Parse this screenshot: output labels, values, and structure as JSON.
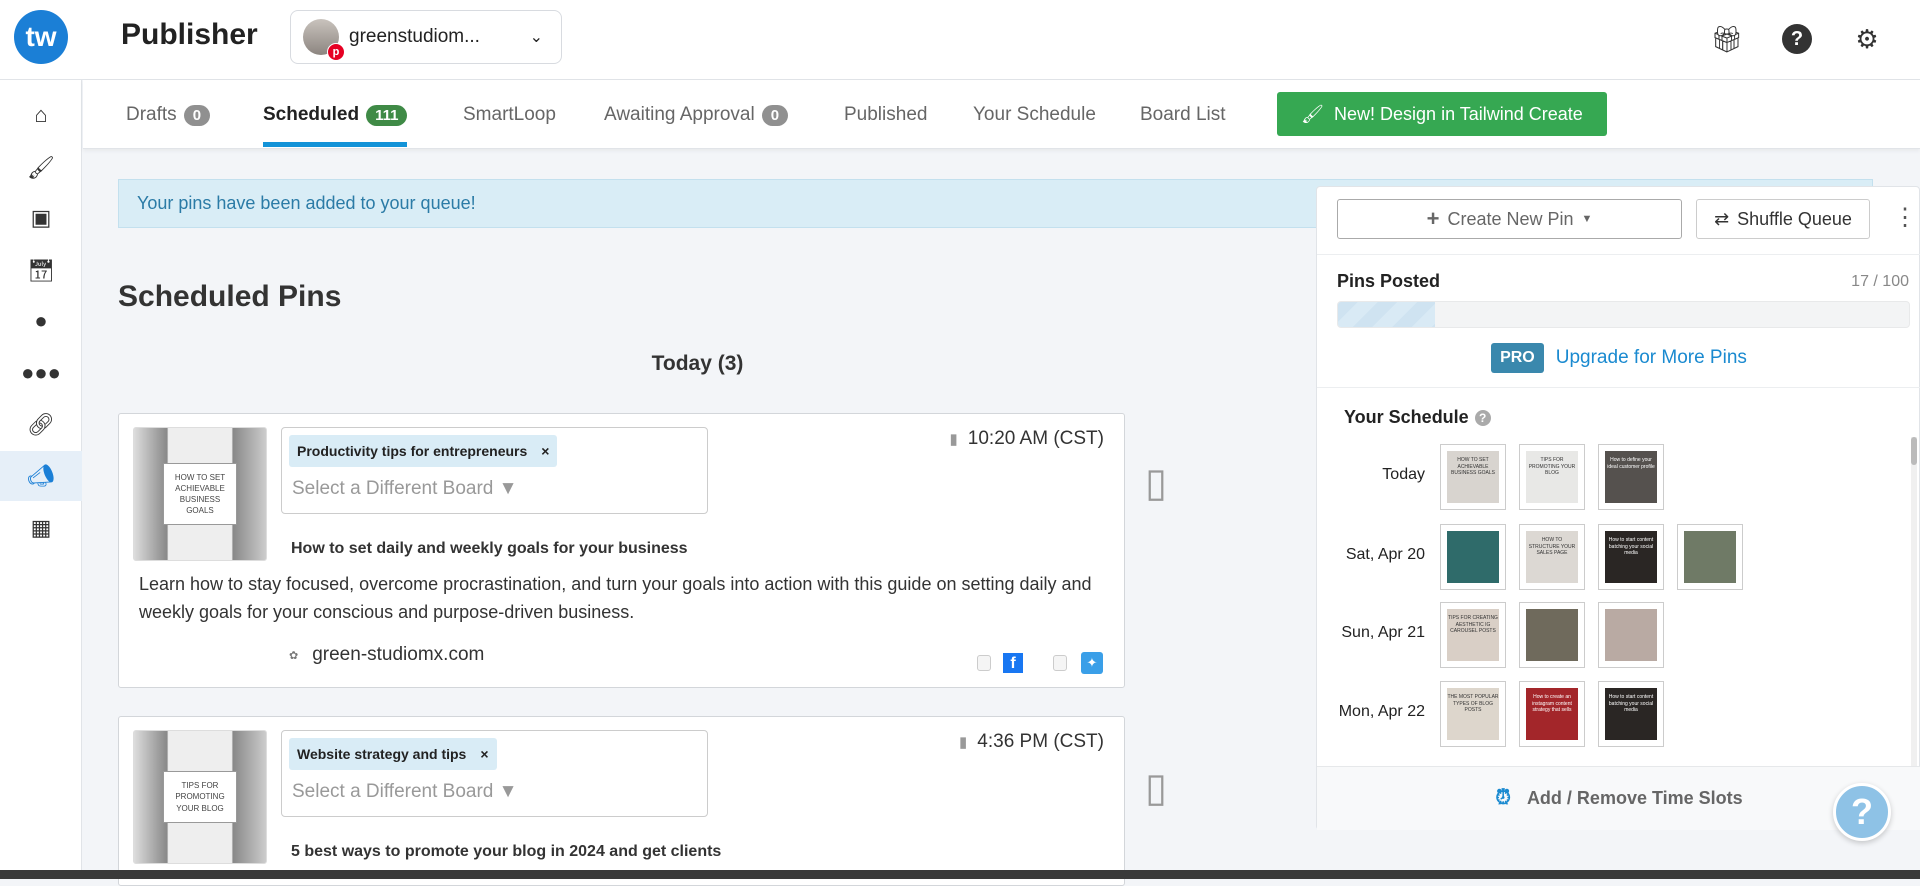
{
  "header": {
    "logo": "tw",
    "title": "Publisher",
    "account": "greenstudiom...",
    "icons": [
      "gift-icon",
      "help-icon",
      "gear-icon"
    ]
  },
  "sidebar": {
    "items": [
      {
        "icon": "home-icon"
      },
      {
        "icon": "brush-icon"
      },
      {
        "icon": "images-icon"
      },
      {
        "icon": "calendar-icon"
      },
      {
        "icon": "bird-icon"
      },
      {
        "icon": "people-icon"
      },
      {
        "icon": "link-icon"
      },
      {
        "icon": "megaphone-icon",
        "active": true
      },
      {
        "icon": "analytics-icon"
      }
    ]
  },
  "tabs": [
    {
      "label": "Drafts",
      "badge": "0"
    },
    {
      "label": "Scheduled",
      "badge": "111",
      "active": true
    },
    {
      "label": "SmartLoop"
    },
    {
      "label": "Awaiting Approval",
      "badge": "0"
    },
    {
      "label": "Published"
    },
    {
      "label": "Your Schedule"
    },
    {
      "label": "Board List"
    }
  ],
  "create_button": "New! Design in Tailwind Create",
  "alert": "Your pins have been added to your queue!",
  "main": {
    "title": "Scheduled Pins",
    "day_heading": "Today (3)",
    "pins": [
      {
        "thumb_text": "HOW TO SET ACHIEVABLE BUSINESS GOALS",
        "board": "Productivity tips for entrepreneurs",
        "remove": "×",
        "select_placeholder": "Select a Different Board ▼",
        "time": "10:20 AM (CST)",
        "title": "How to set daily and weekly goals for your business",
        "description": "Learn how to stay focused, overcome procrastination, and turn your goals into action with this guide on setting daily and weekly goals for your conscious and purpose-driven business.",
        "link": "green-studiomx.com"
      },
      {
        "thumb_text": "TIPS FOR PROMOTING YOUR BLOG",
        "board": "Website strategy and tips",
        "remove": "×",
        "select_placeholder": "Select a Different Board ▼",
        "time": "4:36 PM (CST)",
        "title": "5 best ways to promote your blog in 2024 and get clients"
      }
    ]
  },
  "panel": {
    "create_pin": "Create New Pin",
    "shuffle": "Shuffle Queue",
    "pins_posted_label": "Pins Posted",
    "pins_posted_count": "17 / 100",
    "pins_posted_fraction": 0.17,
    "pro": "PRO",
    "upgrade": "Upgrade for More Pins",
    "schedule_title": "Your Schedule",
    "footer": "Add / Remove Time Slots",
    "schedule": [
      {
        "day": "Today",
        "thumbs": [
          {
            "text": "HOW TO SET ACHIEVABLE BUSINESS GOALS",
            "color": "#d8d4cf"
          },
          {
            "text": "TIPS FOR PROMOTING YOUR BLOG",
            "color": "#e8e8e6"
          },
          {
            "text": "How to define your ideal customer profile",
            "color": "#55514e"
          }
        ]
      },
      {
        "day": "Sat, Apr 20",
        "thumbs": [
          {
            "text": "",
            "color": "#2f6b6a"
          },
          {
            "text": "HOW TO STRUCTURE YOUR SALES PAGE",
            "color": "#dcd8d3"
          },
          {
            "text": "How to start content batching your social media",
            "color": "#2a2624"
          },
          {
            "text": "",
            "color": "#6f7a66"
          }
        ]
      },
      {
        "day": "Sun, Apr 21",
        "thumbs": [
          {
            "text": "TIPS FOR CREATING AESTHETIC IG CAROUSEL POSTS",
            "color": "#d9cfc6"
          },
          {
            "text": "",
            "color": "#6f6a5c"
          },
          {
            "text": "",
            "color": "#b9aaa3"
          }
        ]
      },
      {
        "day": "Mon, Apr 22",
        "thumbs": [
          {
            "text": "THE MOST POPULAR TYPES OF BLOG POSTS",
            "color": "#ddd6cc"
          },
          {
            "text": "How to create an instagram content strategy that sells",
            "color": "#a3262a"
          },
          {
            "text": "How to start content batching your social media",
            "color": "#2a2624"
          }
        ]
      }
    ]
  },
  "help_button": "?"
}
